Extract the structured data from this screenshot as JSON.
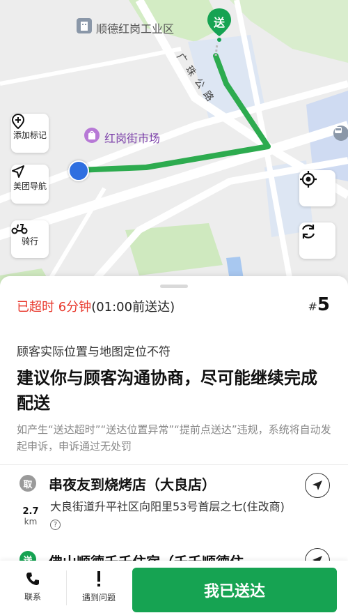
{
  "map": {
    "poi_industrial": "顺德红岗工业区",
    "poi_market": "红岗街市场",
    "road_name": "广珠公路",
    "destination_pin": "送",
    "buttons": {
      "add_marker": "添加标记",
      "meituan_nav": "美团导航",
      "ride": "骑行"
    },
    "colors": {
      "route": "#2dab4f",
      "pin": "#16a352",
      "rider": "#2f6fe0"
    }
  },
  "panel": {
    "overtime_red": "已超时 6分钟",
    "overtime_rest": "(01:00前送达)",
    "order_hash": "#",
    "order_number": "5",
    "warning_subtitle": "顾客实际位置与地图定位不符",
    "warning_title": "建议你与顾客沟通协商，尽可能继续完成配送",
    "warning_note": "如产生“送达超时”“送达位置异常”“提前点送达”违规，系统将自动发起申诉，申诉通过无处罚",
    "pickup": {
      "badge": "取",
      "shop_name": "串夜友到烧烤店（大良店）",
      "distance_value": "2.7",
      "distance_unit": "km",
      "address": "大良街道升平社区向阳里53号首层之七(住改商)"
    },
    "delivery": {
      "badge": "送",
      "name": "佛山顺德千千住宿（千千顺德住"
    }
  },
  "bottom_bar": {
    "contact": "联系",
    "problem": "遇到问题",
    "delivered": "我已送达"
  }
}
